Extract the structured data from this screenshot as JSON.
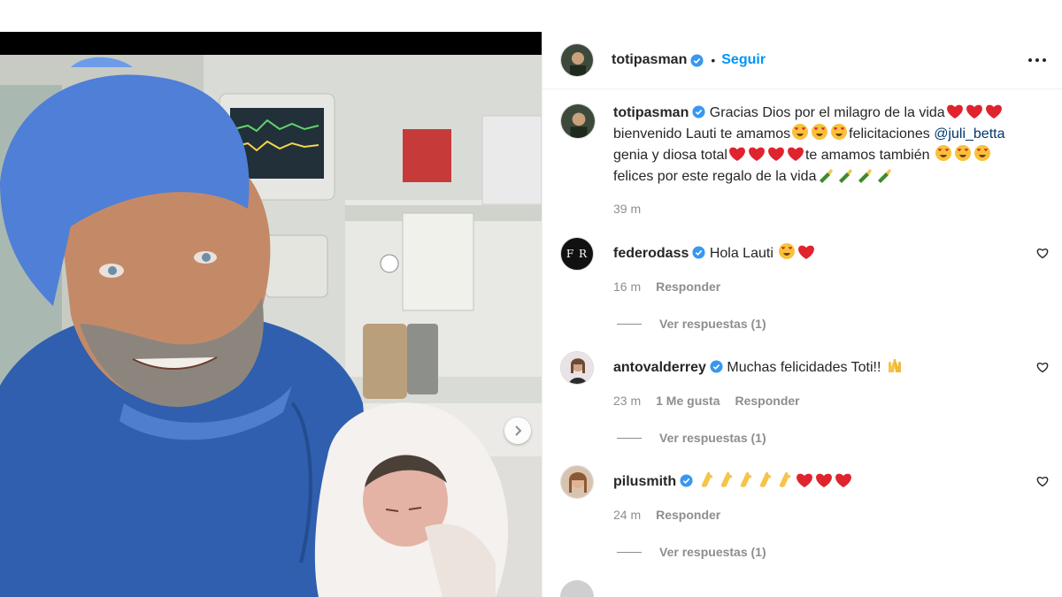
{
  "post": {
    "author": "totipasman",
    "follow_label": "Seguir",
    "separator": "•",
    "caption": {
      "part1": "Gracias Dios por el milagro de la vida",
      "part2": "bienvenido Lauti te amamos",
      "part3": "felicitaciones",
      "mention": "@juli_betta",
      "part4": "genia y diosa total",
      "part5": "te amamos también",
      "part6": "felices por este regalo de la vida"
    },
    "time": "39 m"
  },
  "comments": [
    {
      "user": "federodass",
      "text": "Hola Lauti",
      "time": "16 m",
      "likes": "",
      "reply": "Responder",
      "view_replies": "Ver respuestas (1)",
      "avatar_text": "F R"
    },
    {
      "user": "antovalderrey",
      "text": "Muchas felicidades Toti!!",
      "time": "23 m",
      "likes": "1 Me gusta",
      "reply": "Responder",
      "view_replies": "Ver respuestas (1)"
    },
    {
      "user": "pilusmith",
      "text": "",
      "time": "24 m",
      "likes": "",
      "reply": "Responder",
      "view_replies": "Ver respuestas (1)"
    }
  ],
  "icons": {
    "verified": "verified-badge-icon",
    "heart": "heart-outline-icon",
    "more": "more-options-icon",
    "next": "chevron-right-icon"
  },
  "colors": {
    "accent": "#0095f6",
    "verified": "#3897f0",
    "mention": "#00376b",
    "muted": "#8e8e8e"
  }
}
